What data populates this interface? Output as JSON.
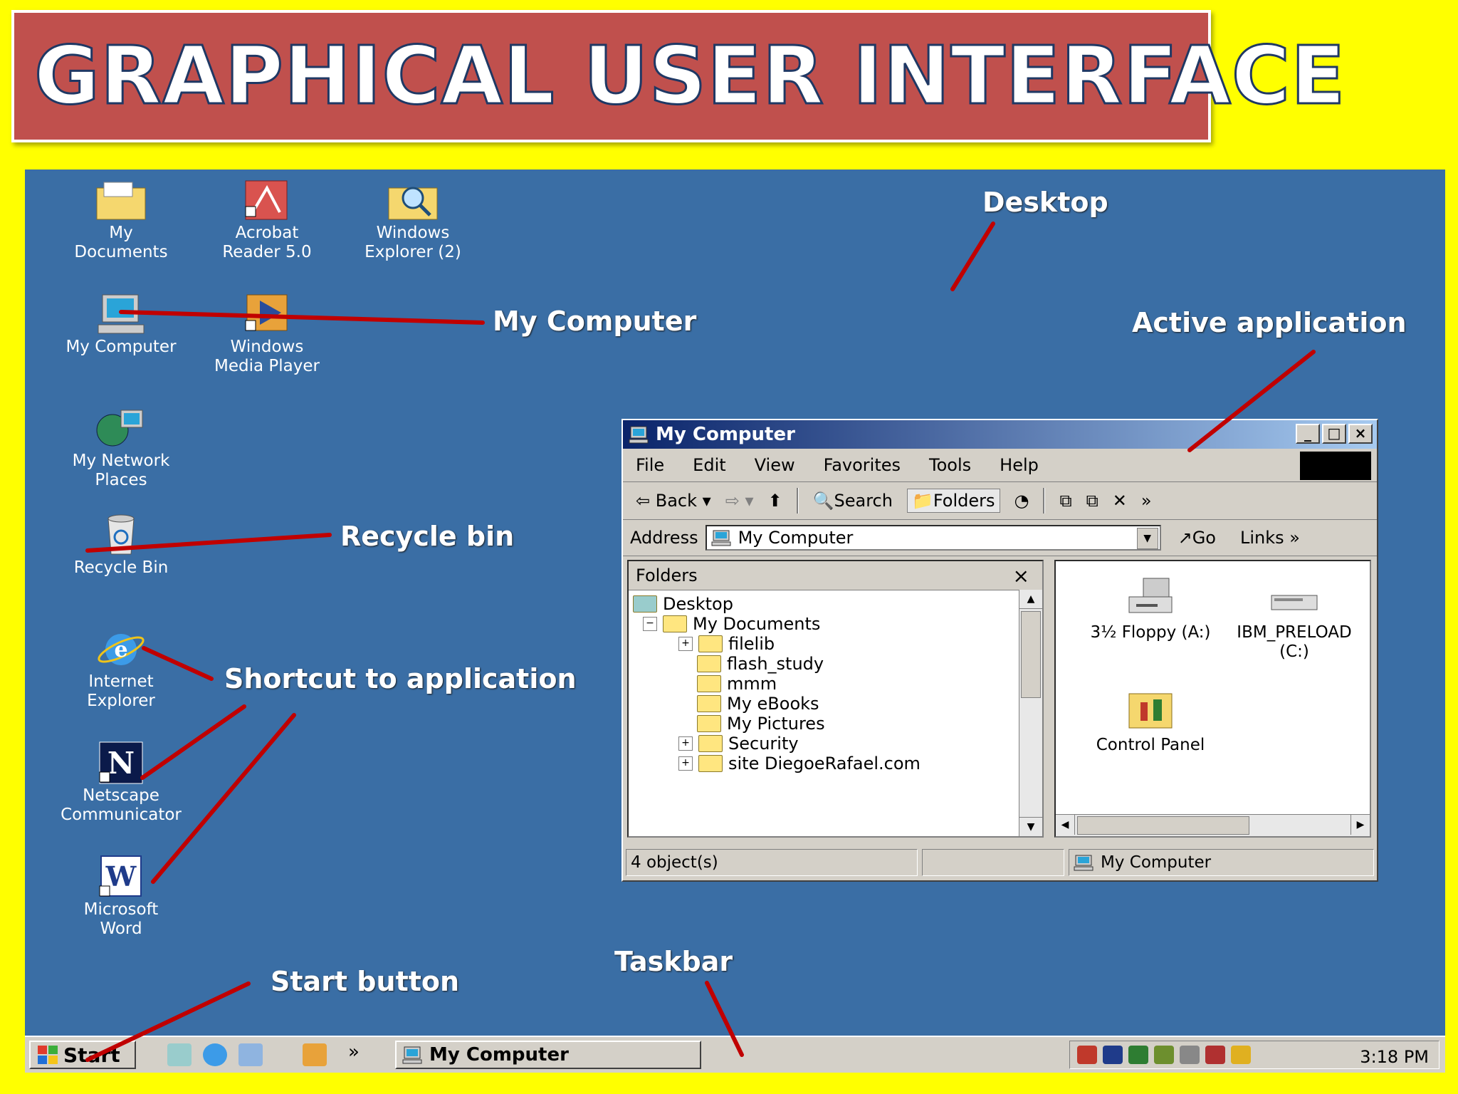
{
  "slide_title": "GRAPHICAL USER INTERFACE",
  "desktop_icons": [
    {
      "label": "My Documents"
    },
    {
      "label": "Acrobat Reader 5.0"
    },
    {
      "label": "Windows Explorer (2)"
    },
    {
      "label": "My Computer"
    },
    {
      "label": "Windows Media Player"
    },
    {
      "label": "My Network Places"
    },
    {
      "label": "Recycle Bin"
    },
    {
      "label": "Internet Explorer"
    },
    {
      "label": "Netscape Communicator"
    },
    {
      "label": "Microsoft Word"
    }
  ],
  "annotations": {
    "desktop": "Desktop",
    "my_computer": "My Computer",
    "active_application": "Active application",
    "recycle_bin": "Recycle bin",
    "shortcut": "Shortcut to application",
    "start_button": "Start button",
    "taskbar": "Taskbar"
  },
  "colors": {
    "slide_background": "#ffff00",
    "banner": "#c0504d",
    "desktop": "#3a6ea5",
    "annotation_line": "#c00000"
  },
  "window": {
    "title": "My Computer",
    "menu": [
      "File",
      "Edit",
      "View",
      "Favorites",
      "Tools",
      "Help"
    ],
    "toolbar": {
      "back": "Back",
      "search": "Search",
      "folders": "Folders"
    },
    "address_label": "Address",
    "address_value": "My Computer",
    "go": "Go",
    "links": "Links",
    "folders_pane_title": "Folders",
    "tree": [
      "Desktop",
      "My Documents",
      "filelib",
      "flash_study",
      "mmm",
      "My eBooks",
      "My Pictures",
      "Security",
      "site DiegoeRafael.com"
    ],
    "content_items": [
      {
        "label": "3½ Floppy (A:)"
      },
      {
        "label": "IBM_PRELOAD (C:)"
      },
      {
        "label": "Control Panel"
      }
    ],
    "status_left": "4 object(s)",
    "status_right": "My Computer"
  },
  "taskbar": {
    "start_label": "Start",
    "task_label": "My Computer",
    "clock": "3:18 PM"
  }
}
